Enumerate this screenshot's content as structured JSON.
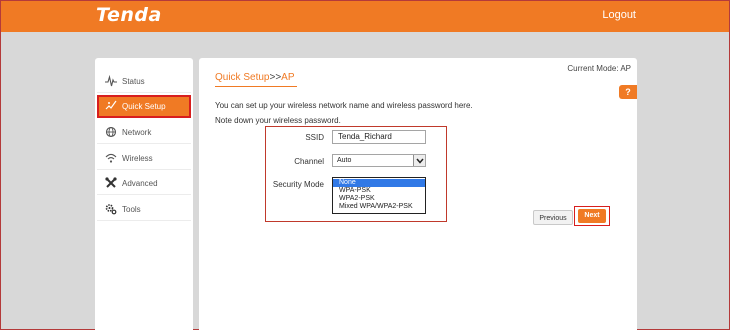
{
  "header": {
    "logo": "Tenda",
    "logout_label": "Logout"
  },
  "sidebar": {
    "items": [
      {
        "label": "Status",
        "icon": "pulse-icon"
      },
      {
        "label": "Quick Setup",
        "icon": "wand-icon",
        "active": true
      },
      {
        "label": "Network",
        "icon": "globe-icon"
      },
      {
        "label": "Wireless",
        "icon": "wifi-icon"
      },
      {
        "label": "Advanced",
        "icon": "tools-icon"
      },
      {
        "label": "Tools",
        "icon": "gears-icon"
      }
    ]
  },
  "main": {
    "current_mode": "Current Mode: AP",
    "breadcrumb": {
      "link": "Quick Setup",
      "sep": ">>",
      "current": "AP"
    },
    "help_label": "?",
    "desc_line1": "You can set up your wireless network name and wireless password here.",
    "desc_line2": "Note down your wireless password.",
    "form": {
      "ssid_label": "SSID",
      "ssid_value": "Tenda_Richard",
      "channel_label": "Channel",
      "channel_value": "Auto",
      "security_label": "Security Mode",
      "security_options": [
        "None",
        "WPA-PSK",
        "WPA2-PSK",
        "Mixed WPA/WPA2-PSK"
      ],
      "security_selected": "None"
    },
    "buttons": {
      "previous": "Previous",
      "next": "Next"
    }
  },
  "colors": {
    "brand": "#f07a24",
    "highlight_border": "#d81e1e",
    "selection": "#3179e6"
  }
}
